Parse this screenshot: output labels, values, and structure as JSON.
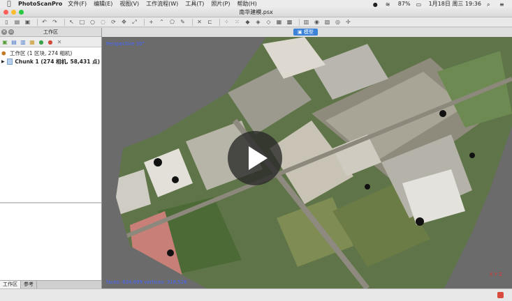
{
  "menubar": {
    "app_name": "PhotoScanPro",
    "menus": [
      "文件(F)",
      "编辑(E)",
      "视图(V)",
      "工作流程(W)",
      "工具(T)",
      "照片(P)",
      "帮助(H)"
    ],
    "battery": "87%",
    "datetime": "1月18日 周三  19:36"
  },
  "window": {
    "title": "南华建模.psx"
  },
  "left_panel": {
    "title": "工作区",
    "tree": {
      "workspace_label": "工作区 (1 区块, 274 相机)",
      "chunk_label": "Chunk 1 (274 相机, 58,431 点)"
    },
    "tabs": [
      "工作区",
      "参考"
    ]
  },
  "viewport": {
    "tab_label": "模型",
    "perspective": "Perspective 30°",
    "stats": "faces: 634,699 vertices: 318,526",
    "axes_label": "X Y Z"
  }
}
